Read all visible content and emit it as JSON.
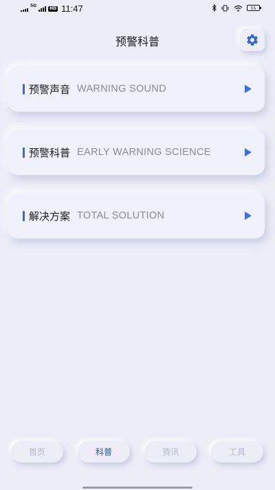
{
  "status_bar": {
    "network": "5G",
    "hd": "HD",
    "time": "11:47",
    "battery": "55"
  },
  "header": {
    "title": "预警科普"
  },
  "cards": [
    {
      "title": "预警声音",
      "subtitle": "WARNING SOUND"
    },
    {
      "title": "预警科普",
      "subtitle": "EARLY WARNING SCIENCE"
    },
    {
      "title": "解决方案",
      "subtitle": "TOTAL SOLUTION"
    }
  ],
  "tabs": [
    {
      "label": "首页"
    },
    {
      "label": "科普"
    },
    {
      "label": "资讯"
    },
    {
      "label": "工具"
    }
  ],
  "colors": {
    "background": "#ecedf7",
    "accent": "#3b64d6",
    "active_tab": "#2f4faa",
    "inactive_tab": "#b3b7cc"
  },
  "icons": {
    "settings": "gear-icon",
    "card_action": "play-arrow-icon"
  }
}
